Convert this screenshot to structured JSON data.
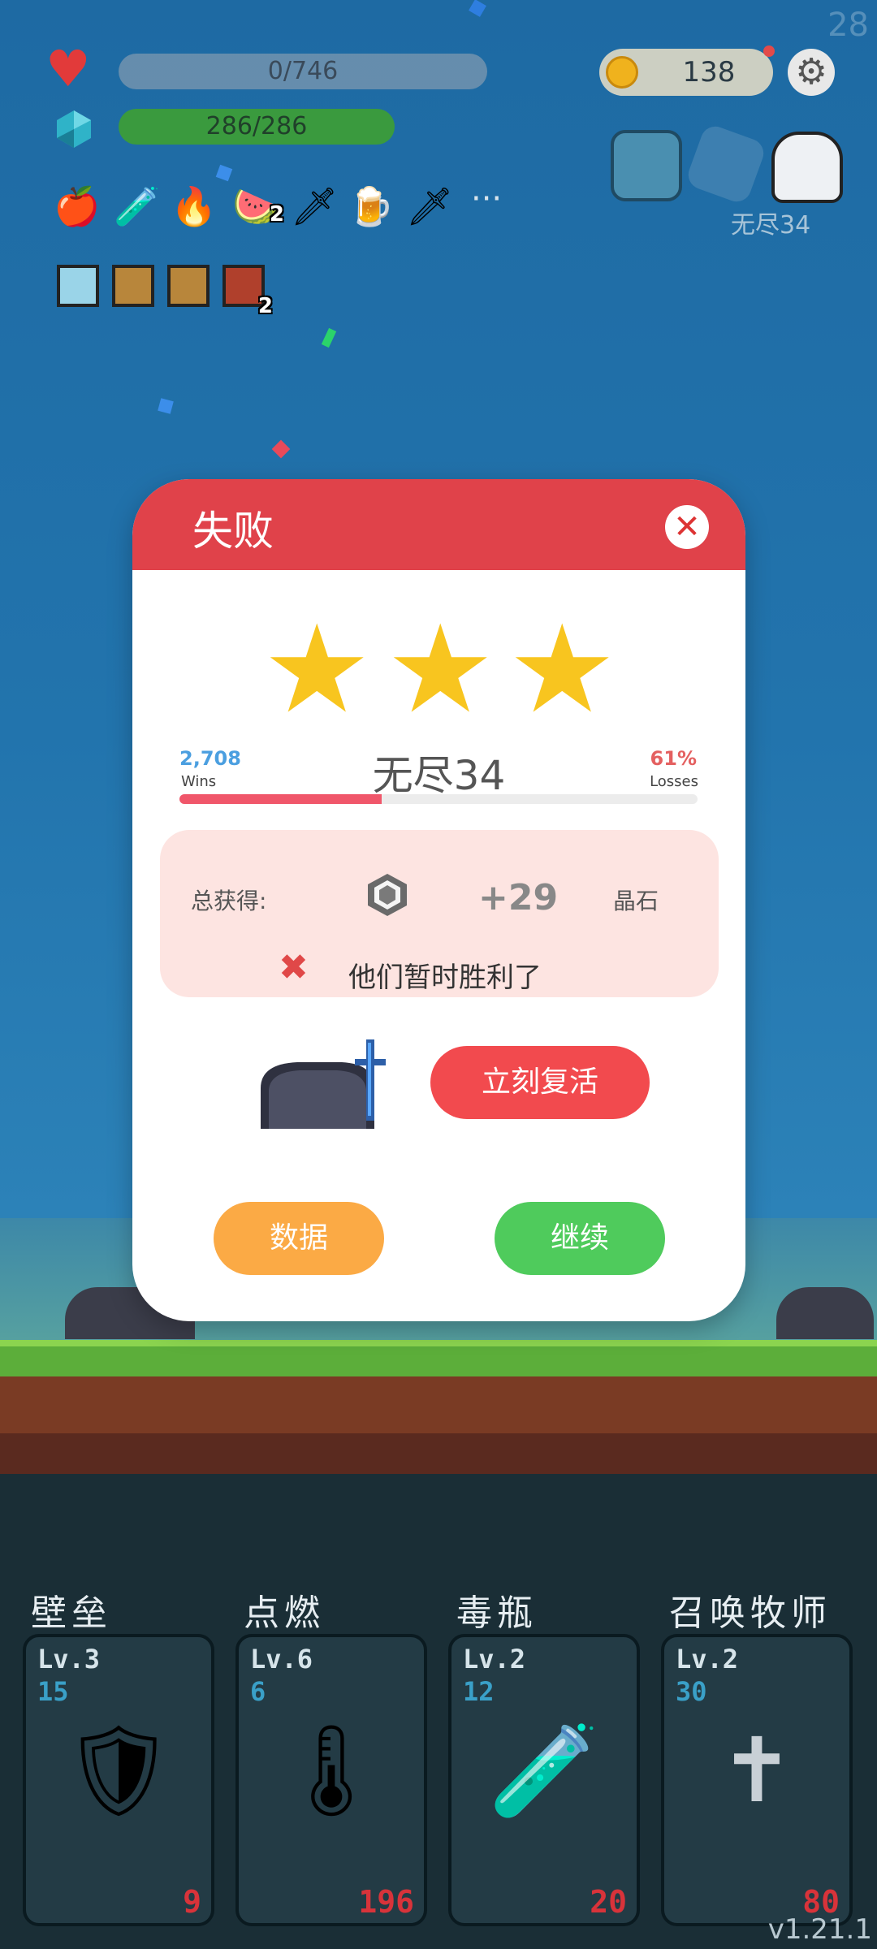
{
  "hud": {
    "fps": "28",
    "health": "0/746",
    "mana": "286/286",
    "coins": "138",
    "stage_label": "无尽34",
    "items": [
      {
        "icon": "apple-icon",
        "glyph": "🍎",
        "count": ""
      },
      {
        "icon": "potion-flag-icon",
        "glyph": "🧪",
        "count": ""
      },
      {
        "icon": "fire-ring-icon",
        "glyph": "🔥",
        "count": ""
      },
      {
        "icon": "watermelon-icon",
        "glyph": "🍉",
        "count": "2"
      },
      {
        "icon": "dagger-icon",
        "glyph": "🗡",
        "count": ""
      },
      {
        "icon": "beer-icon",
        "glyph": "🍺",
        "count": ""
      },
      {
        "icon": "sword-icon",
        "glyph": "🗡",
        "count": ""
      }
    ],
    "more": "···",
    "relics": [
      {
        "icon": "lightbulb-relic-icon",
        "count": ""
      },
      {
        "icon": "shield-relic-icon",
        "count": ""
      },
      {
        "icon": "shield-relic-icon",
        "count": ""
      },
      {
        "icon": "flame-relic-icon",
        "count": "2"
      }
    ]
  },
  "modal": {
    "title": "失败",
    "stars": 3,
    "wins_value": "2,708",
    "wins_label": "Wins",
    "stage": "无尽34",
    "losses_value": "61%",
    "losses_label": "Losses",
    "win_fraction": 0.39,
    "reward_label": "总获得:",
    "reward_amount": "+29",
    "reward_unit": "晶石",
    "fail_text": "他们暂时胜利了",
    "revive": "立刻复活",
    "stats": "数据",
    "continue": "继续"
  },
  "skills": [
    {
      "name": "壁垒",
      "level": "Lv.3",
      "cost": "15",
      "value": "9",
      "icon": "armor-icon",
      "glyph": "🛡"
    },
    {
      "name": "点燃",
      "level": "Lv.6",
      "cost": "6",
      "value": "196",
      "icon": "thermometer-icon",
      "glyph": "🌡"
    },
    {
      "name": "毒瓶",
      "level": "Lv.2",
      "cost": "12",
      "value": "20",
      "icon": "poison-flask-icon",
      "glyph": "🧪"
    },
    {
      "name": "召唤牧师",
      "level": "Lv.2",
      "cost": "30",
      "value": "80",
      "icon": "cross-icon",
      "glyph": "✝"
    }
  ],
  "version": "v1.21.1",
  "colors": {
    "modal_header": "#e0424a",
    "revive": "#f24a4e",
    "stats": "#fbaa45",
    "continue": "#4fcb5c"
  }
}
